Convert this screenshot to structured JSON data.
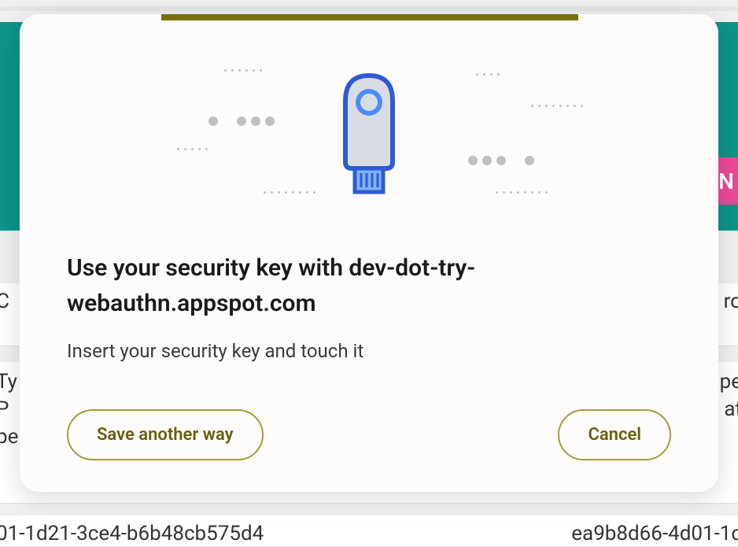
{
  "background": {
    "badge_letter": "N",
    "row1_left": "C",
    "row1_right": "ro",
    "row2_left": "Ty",
    "row2_left2": "P",
    "row2_left3": "pe",
    "row2_right": "pe",
    "row2_right2": "at",
    "row3_left": "01-1d21-3ce4-b6b48cb575d4",
    "row3_right": "ea9b8d66-4d01-1c"
  },
  "modal": {
    "title": "Use your security key with dev-dot-try-webauthn.appspot.com",
    "description": "Insert your security key and touch it",
    "buttons": {
      "save_another_way": "Save another way",
      "cancel": "Cancel"
    }
  }
}
